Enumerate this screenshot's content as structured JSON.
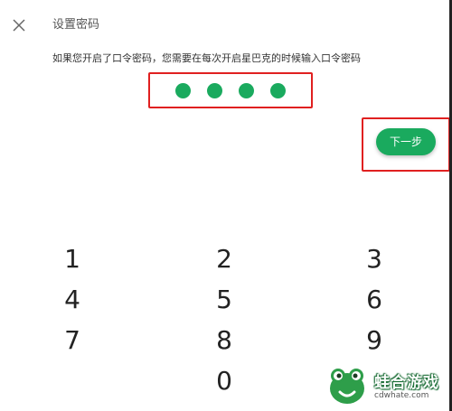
{
  "header": {
    "close_icon": "close-icon",
    "title": "设置密码"
  },
  "hint": "如果您开启了口令密码，您需要在每次开启星巴克的时候输入口令密码",
  "pin": {
    "entered_count": 4,
    "dot_color": "#1aaa5e"
  },
  "next_button": {
    "label": "下一步",
    "color": "#1aaa5e"
  },
  "highlight_color": "#e02020",
  "keypad": {
    "keys": [
      "1",
      "2",
      "3",
      "4",
      "5",
      "6",
      "7",
      "8",
      "9",
      "0"
    ]
  },
  "watermark": {
    "title": "蛙合游戏",
    "url": "cdwhate.com"
  }
}
